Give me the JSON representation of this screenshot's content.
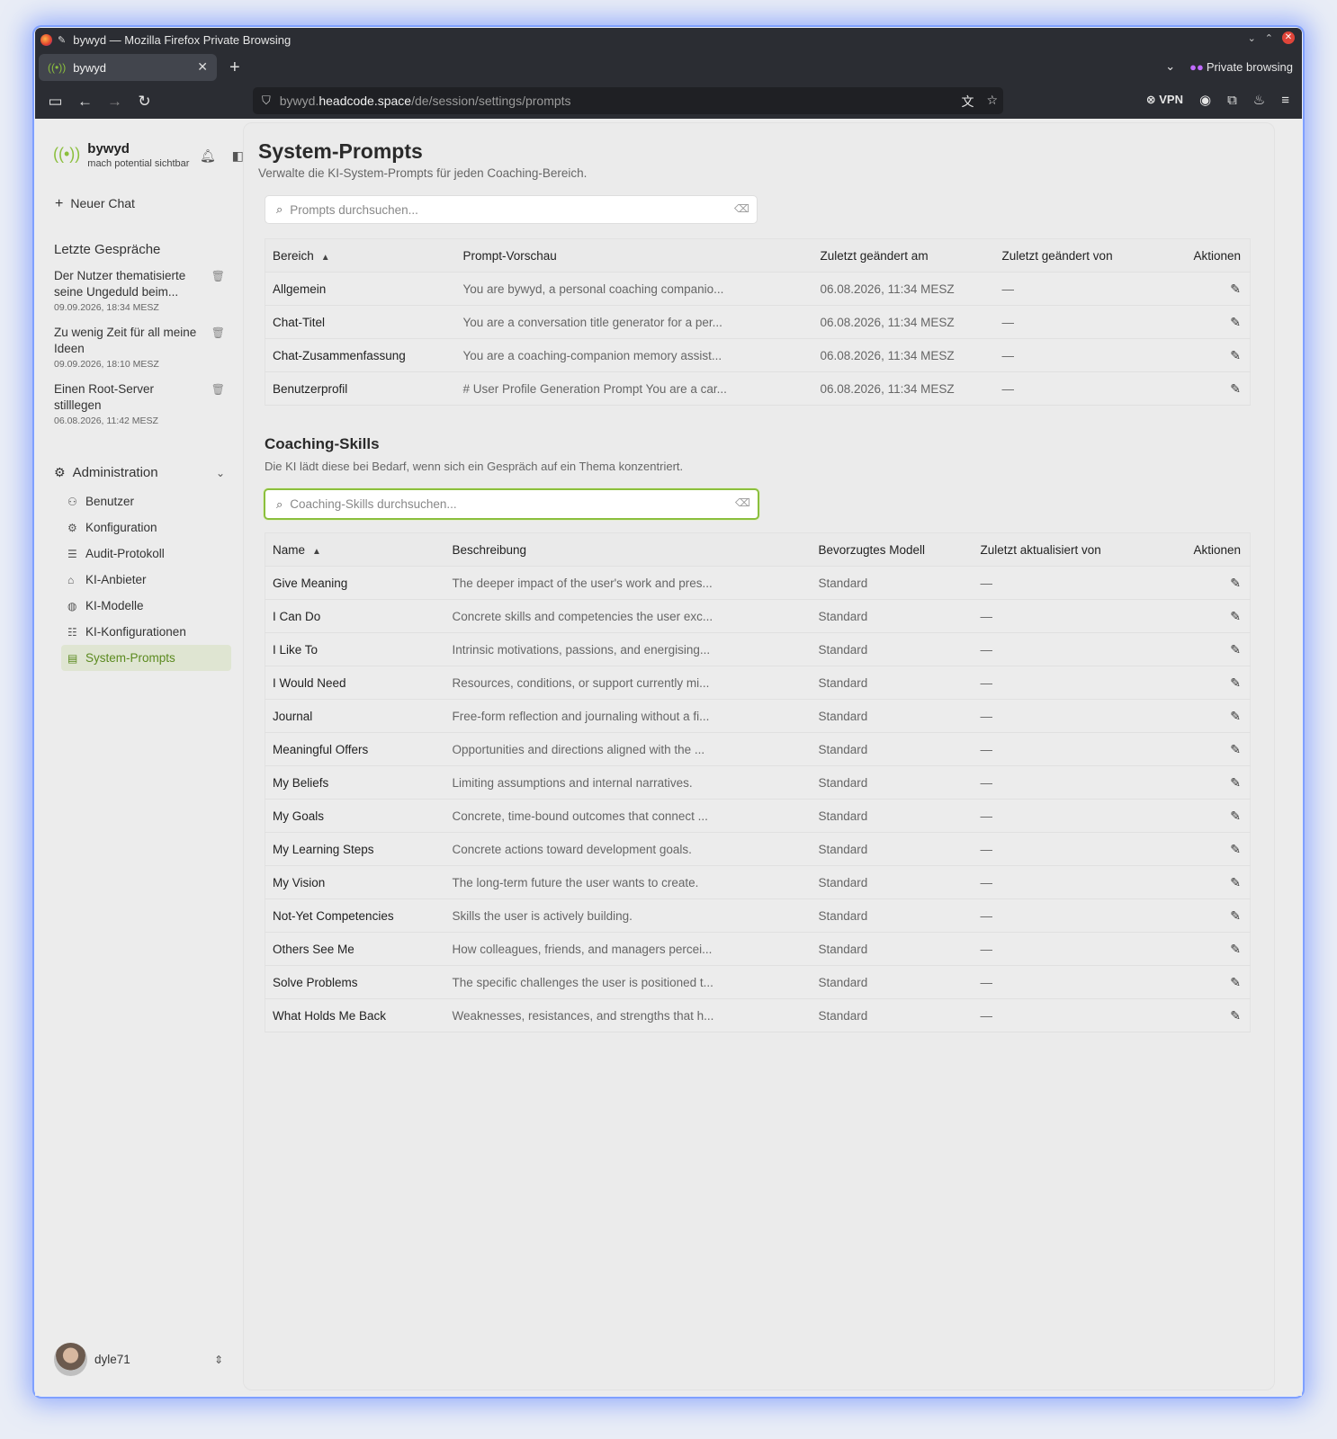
{
  "browser": {
    "window_title": "bywyd — Mozilla Firefox Private Browsing",
    "tab_title": "bywyd",
    "private_label": "Private browsing",
    "url_prefix": "bywyd.",
    "url_host": "headcode.space",
    "url_path": "/de/session/settings/prompts",
    "vpn_label": "VPN"
  },
  "sidebar": {
    "brand_name": "bywyd",
    "brand_tagline": "mach potential sichtbar",
    "new_chat": "Neuer Chat",
    "recent_title": "Letzte Gespräche",
    "conversations": [
      {
        "title": "Der Nutzer thematisierte seine Ungeduld beim...",
        "date": "09.09.2026, 18:34 MESZ"
      },
      {
        "title": "Zu wenig Zeit für all meine Ideen",
        "date": "09.09.2026, 18:10 MESZ"
      },
      {
        "title": "Einen Root-Server stilllegen",
        "date": "06.08.2026, 11:42 MESZ"
      }
    ],
    "admin_title": "Administration",
    "admin_items": [
      {
        "label": "Benutzer",
        "icon": "users-icon",
        "glyph": "⚇"
      },
      {
        "label": "Konfiguration",
        "icon": "gear-icon",
        "glyph": "⚙"
      },
      {
        "label": "Audit-Protokoll",
        "icon": "list-icon",
        "glyph": "☰"
      },
      {
        "label": "KI-Anbieter",
        "icon": "plug-icon",
        "glyph": "⌂"
      },
      {
        "label": "KI-Modelle",
        "icon": "brain-icon",
        "glyph": "◍"
      },
      {
        "label": "KI-Konfigurationen",
        "icon": "sliders-icon",
        "glyph": "☷"
      },
      {
        "label": "System-Prompts",
        "icon": "message-icon",
        "glyph": "▤",
        "active": true
      }
    ],
    "username": "dyle71"
  },
  "main": {
    "title": "System-Prompts",
    "subtitle": "Verwalte die KI-System-Prompts für jeden Coaching-Bereich.",
    "search_placeholder": "Prompts durchsuchen...",
    "prompts_table": {
      "headers": [
        "Bereich",
        "Prompt-Vorschau",
        "Zuletzt geändert am",
        "Zuletzt geändert von",
        "Aktionen"
      ],
      "rows": [
        {
          "area": "Allgemein",
          "preview": "You are bywyd, a personal coaching companio...",
          "changed_at": "06.08.2026, 11:34 MESZ",
          "changed_by": "—"
        },
        {
          "area": "Chat-Titel",
          "preview": "You are a conversation title generator for a per...",
          "changed_at": "06.08.2026, 11:34 MESZ",
          "changed_by": "—"
        },
        {
          "area": "Chat-Zusammenfassung",
          "preview": "You are a coaching-companion memory assist...",
          "changed_at": "06.08.2026, 11:34 MESZ",
          "changed_by": "—"
        },
        {
          "area": "Benutzerprofil",
          "preview": "# User Profile Generation Prompt You are a car...",
          "changed_at": "06.08.2026, 11:34 MESZ",
          "changed_by": "—"
        }
      ]
    },
    "skills_title": "Coaching-Skills",
    "skills_subtitle": "Die KI lädt diese bei Bedarf, wenn sich ein Gespräch auf ein Thema konzentriert.",
    "skills_search_placeholder": "Coaching-Skills durchsuchen...",
    "skills_table": {
      "headers": [
        "Name",
        "Beschreibung",
        "Bevorzugtes Modell",
        "Zuletzt aktualisiert von",
        "Aktionen"
      ],
      "rows": [
        {
          "name": "Give Meaning",
          "desc": "The deeper impact of the user's work and pres...",
          "model": "Standard",
          "by": "—"
        },
        {
          "name": "I Can Do",
          "desc": "Concrete skills and competencies the user exc...",
          "model": "Standard",
          "by": "—"
        },
        {
          "name": "I Like To",
          "desc": "Intrinsic motivations, passions, and energising...",
          "model": "Standard",
          "by": "—"
        },
        {
          "name": "I Would Need",
          "desc": "Resources, conditions, or support currently mi...",
          "model": "Standard",
          "by": "—"
        },
        {
          "name": "Journal",
          "desc": "Free-form reflection and journaling without a fi...",
          "model": "Standard",
          "by": "—"
        },
        {
          "name": "Meaningful Offers",
          "desc": "Opportunities and directions aligned with the ...",
          "model": "Standard",
          "by": "—"
        },
        {
          "name": "My Beliefs",
          "desc": "Limiting assumptions and internal narratives.",
          "model": "Standard",
          "by": "—"
        },
        {
          "name": "My Goals",
          "desc": "Concrete, time-bound outcomes that connect ...",
          "model": "Standard",
          "by": "—"
        },
        {
          "name": "My Learning Steps",
          "desc": "Concrete actions toward development goals.",
          "model": "Standard",
          "by": "—"
        },
        {
          "name": "My Vision",
          "desc": "The long-term future the user wants to create.",
          "model": "Standard",
          "by": "—"
        },
        {
          "name": "Not-Yet Competencies",
          "desc": "Skills the user is actively building.",
          "model": "Standard",
          "by": "—"
        },
        {
          "name": "Others See Me",
          "desc": "How colleagues, friends, and managers percei...",
          "model": "Standard",
          "by": "—"
        },
        {
          "name": "Solve Problems",
          "desc": "The specific challenges the user is positioned t...",
          "model": "Standard",
          "by": "—"
        },
        {
          "name": "What Holds Me Back",
          "desc": "Weaknesses, resistances, and strengths that h...",
          "model": "Standard",
          "by": "—"
        }
      ]
    }
  },
  "colors": {
    "accent": "#8bbf3d",
    "active_bg": "#dfe5d2",
    "browser_chrome": "#2b2d33"
  }
}
